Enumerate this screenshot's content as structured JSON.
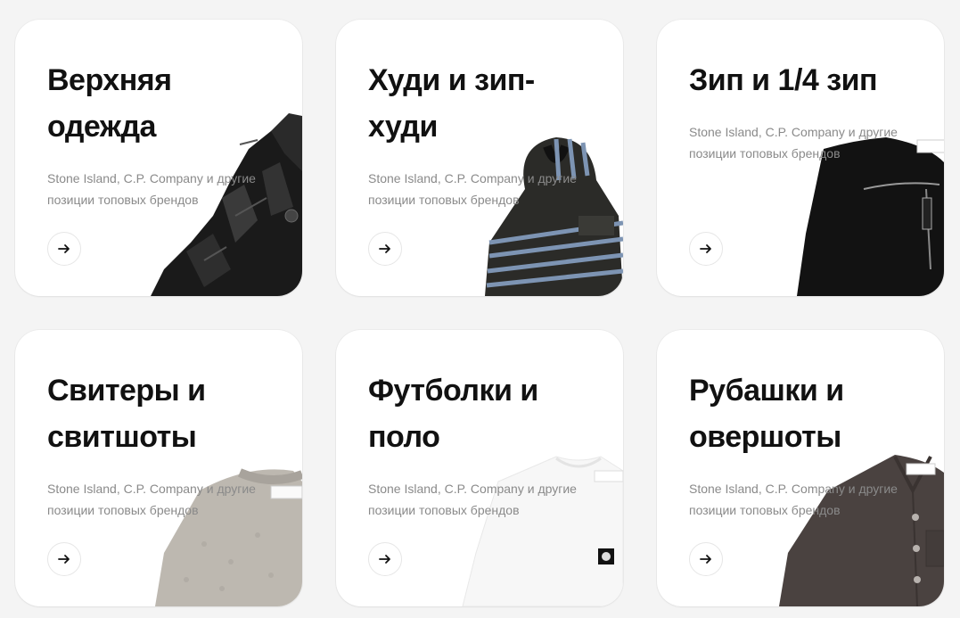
{
  "cards": [
    {
      "title": "Верхняя\nодежда",
      "subtitle": "Stone Island, C.P. Company и другие позиции топовых брендов",
      "image": "black-leather-jacket"
    },
    {
      "title": "Худи и зип-\nхуди",
      "subtitle": "Stone Island, C.P. Company и другие позиции топовых брендов",
      "image": "striped-hoodie"
    },
    {
      "title": "Зип и 1/4 зип",
      "subtitle": "Stone Island, C.P. Company и другие позиции топовых брендов",
      "image": "black-quarter-zip"
    },
    {
      "title": "Свитеры и\nсвитшоты",
      "subtitle": "Stone Island, C.P. Company и другие позиции топовых брендов",
      "image": "grey-knit-sweater"
    },
    {
      "title": "Футболки и\nполо",
      "subtitle": "Stone Island, C.P. Company и другие позиции топовых брендов",
      "image": "white-tshirt"
    },
    {
      "title": "Рубашки и\nовершоты",
      "subtitle": "Stone Island, C.P. Company и другие позиции топовых брендов",
      "image": "brown-overshirt"
    }
  ],
  "colors": {
    "card_bg": "#ffffff",
    "page_bg": "#f4f4f4",
    "title": "#111111",
    "subtitle": "#8a8a8a"
  }
}
